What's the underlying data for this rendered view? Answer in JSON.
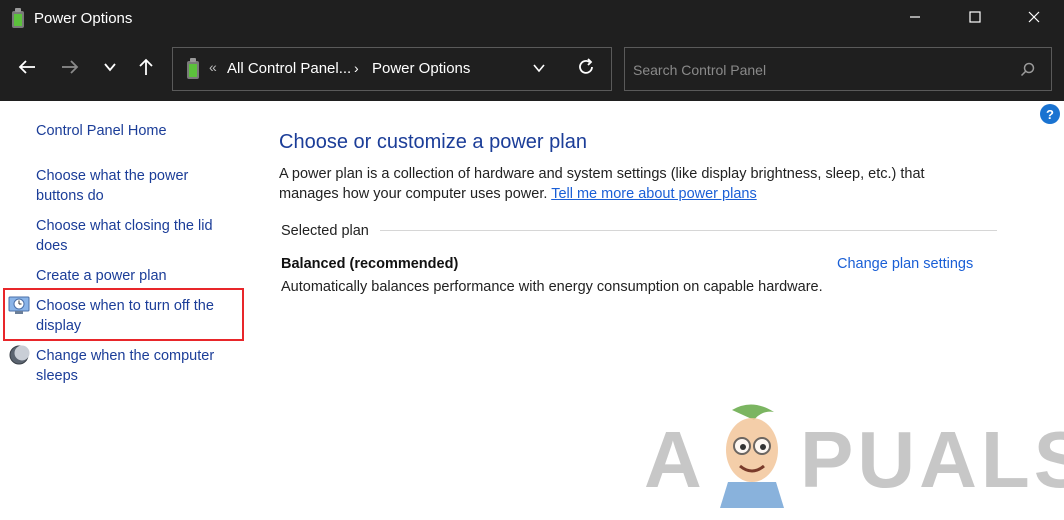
{
  "window": {
    "title": "Power Options",
    "minimize_icon": "minimize-icon",
    "maximize_icon": "maximize-icon",
    "close_icon": "close-icon"
  },
  "navbar": {
    "back_icon": "arrow-left-icon",
    "forward_icon": "arrow-right-icon",
    "recent_icon": "chevron-down-icon",
    "up_icon": "arrow-up-icon",
    "address": {
      "chevrons": "«",
      "crumb1": "All Control Panel...",
      "separator": "›",
      "crumb2": "Power Options",
      "dropdown_icon": "chevron-down-icon",
      "refresh_icon": "refresh-icon"
    },
    "search": {
      "placeholder": "Search Control Panel",
      "value": "",
      "icon": "search-icon"
    }
  },
  "help": {
    "label": "?"
  },
  "sidebar": {
    "home": "Control Panel Home",
    "links": [
      "Choose what the power buttons do",
      "Choose what closing the lid does",
      "Create a power plan",
      "Choose when to turn off the display",
      "Change when the computer sleeps"
    ],
    "highlight_color": "#e8262a"
  },
  "main": {
    "title": "Choose or customize a power plan",
    "description": "A power plan is a collection of hardware and system settings (like display brightness, sleep, etc.) that manages how your computer uses power.",
    "learn_more": "Tell me more about power plans",
    "selected_plan_label": "Selected plan",
    "plan_name": "Balanced (recommended)",
    "change_link": "Change plan settings",
    "plan_description": "Automatically balances performance with energy consumption on capable hardware."
  },
  "watermark": {
    "left": "A",
    "right": "PUALS"
  },
  "colors": {
    "titlebar_bg": "#1f1f1f",
    "link": "#1b3d98",
    "hyperlink": "#1a5fd6",
    "accent": "#1a73d1"
  }
}
